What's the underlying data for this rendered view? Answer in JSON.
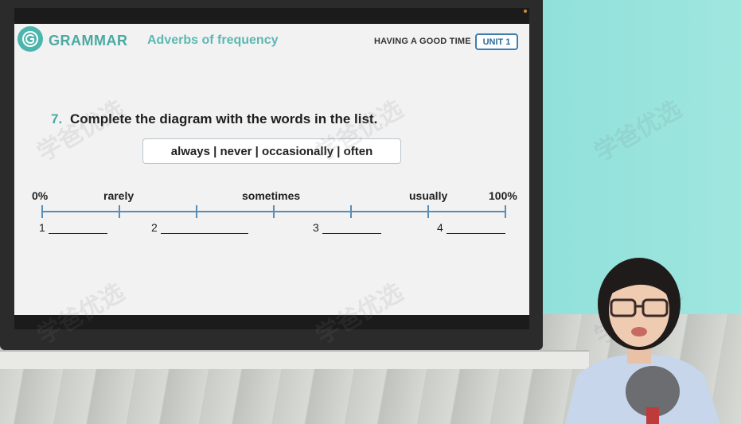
{
  "header": {
    "section_label": "GRAMMAR",
    "topic": "Adverbs of frequency",
    "lesson": "HAVING A GOOD TIME",
    "unit": "UNIT 1"
  },
  "exercise": {
    "number": "7.",
    "instruction": "Complete the diagram with the words in the list.",
    "word_list": "always | never | occasionally | often"
  },
  "scale": {
    "labels": [
      "0%",
      "rarely",
      "sometimes",
      "usually",
      "100%"
    ],
    "blanks": [
      "1",
      "2",
      "3",
      "4"
    ]
  },
  "watermark": "学爸优选",
  "colors": {
    "accent": "#4aa9a2",
    "scale_line": "#5a8cb8",
    "unit_border": "#3d7fb0"
  }
}
